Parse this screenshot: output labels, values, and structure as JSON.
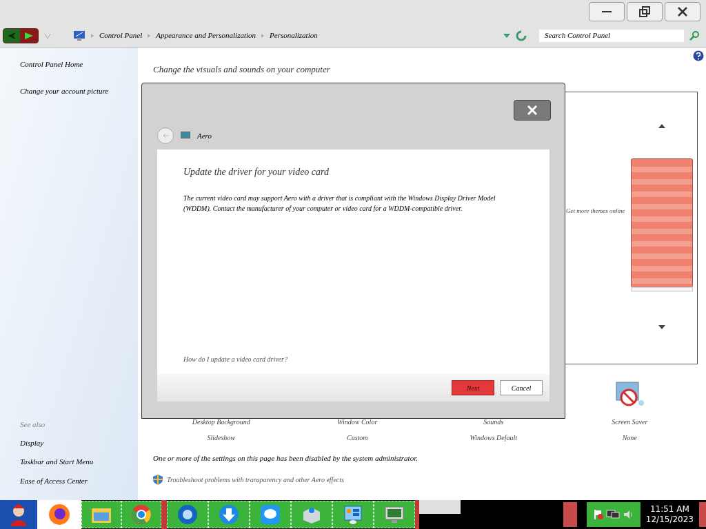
{
  "address_bar": {
    "breadcrumbs": [
      "Control Panel",
      "Appearance and Personalization",
      "Personalization"
    ],
    "search": {
      "placeholder": "Search Control Panel"
    }
  },
  "sidebar": {
    "links": [
      "Control Panel Home",
      "Change your account picture"
    ],
    "see_also_title": "See also",
    "see_also": [
      "Display",
      "Taskbar and Start Menu",
      "Ease of Access Center"
    ]
  },
  "main": {
    "heading": "Change the visuals and sounds on your computer",
    "themes_link": "Get more themes online",
    "settings": [
      {
        "title": "Desktop Background",
        "value": "Slideshow"
      },
      {
        "title": "Window Color",
        "value": "Custom"
      },
      {
        "title": "Sounds",
        "value": "Windows Default"
      },
      {
        "title": "Screen Saver",
        "value": "None"
      }
    ],
    "notice": "One or more of the settings on this page has been disabled by the system administrator.",
    "troubleshoot": "Troubleshoot problems with transparency and other Aero effects"
  },
  "dialog": {
    "title": "Aero",
    "heading": "Update the driver for your video card",
    "body": "The current video card may support Aero with a driver that is compliant with the Windows Display Driver Model (WDDM).  Contact the manufacturer of your computer or video card for a WDDM-compatible driver.",
    "help_link": "How do I update a video card driver?",
    "buttons": [
      {
        "label": "Next",
        "kind": "primary"
      },
      {
        "label": "Cancel",
        "kind": "secondary"
      }
    ]
  },
  "taskbar": {
    "time": "11:51 AM",
    "date": "12/15/2023"
  }
}
